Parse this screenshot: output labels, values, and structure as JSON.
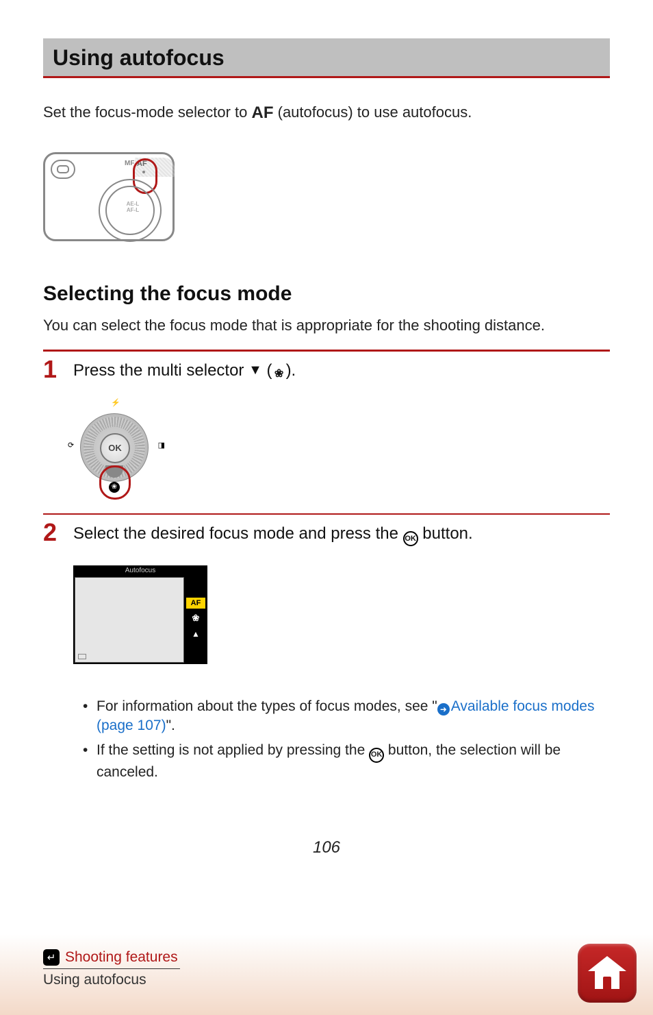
{
  "heading": "Using autofocus",
  "intro": {
    "before": "Set the focus-mode selector to ",
    "af": "AF",
    "after": " (autofocus) to use autofocus."
  },
  "selector_diagram": {
    "mf_label": "MF",
    "af_label": "AF",
    "ael_line1": "AE-L",
    "ael_line2": "AF-L"
  },
  "subheading": "Selecting the focus mode",
  "subdesc": "You can select the focus mode that is appropriate for the shooting distance.",
  "step1": {
    "num": "1",
    "text_before": "Press the multi selector ",
    "arrow": "▼",
    "text_mid": " (",
    "macro_icon": "❀",
    "text_after": ")."
  },
  "multi_selector": {
    "ok_label": "OK",
    "top_glyph": "⚡",
    "left_glyph": "⟳",
    "right_glyph": "◨",
    "down_glyph": "❀"
  },
  "step2": {
    "num": "2",
    "text_before": "Select the desired focus mode and press the ",
    "ok_label": "OK",
    "text_after": " button."
  },
  "screen_preview": {
    "title": "Autofocus",
    "side_af": "AF",
    "side_macro": "❀",
    "side_mountain": "▲"
  },
  "bullets": {
    "bullet": "•",
    "b1_text_before": "For information about the types of focus modes, see \"",
    "link_arrow": "➜",
    "link_text": "Available focus modes (page 107)",
    "b1_text_after": "\".",
    "b2_text_before": "If the setting is not applied by pressing the ",
    "b2_ok": "OK",
    "b2_text_after": " button, the selection will be canceled."
  },
  "page_number": "106",
  "footer": {
    "back_icon": "↵",
    "breadcrumb_top": "Shooting features",
    "breadcrumb_bottom": "Using autofocus"
  }
}
